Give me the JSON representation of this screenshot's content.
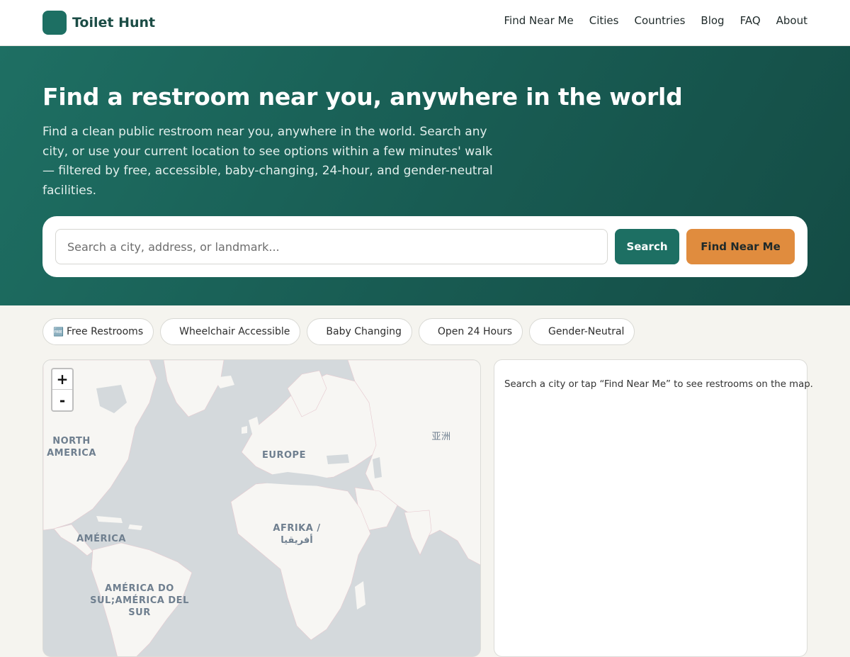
{
  "header": {
    "brand": "Toilet Hunt",
    "nav": [
      "Find Near Me",
      "Cities",
      "Countries",
      "Blog",
      "FAQ",
      "About"
    ]
  },
  "hero": {
    "title": "Find a restroom near you, anywhere in the world",
    "subtitle": "Find a clean public restroom near you, anywhere in the world. Search any city, or use your current location to see options within a few minutes' walk — filtered by free, accessible, baby-changing, 24-hour, and gender-neutral facilities."
  },
  "search": {
    "placeholder": "Search a city, address, or landmark...",
    "search_label": "Search",
    "near_label": "Find Near Me"
  },
  "filters": [
    {
      "label": "Free Restrooms",
      "icon": "🆓"
    },
    {
      "label": "Wheelchair Accessible",
      "icon": ""
    },
    {
      "label": "Baby Changing",
      "icon": ""
    },
    {
      "label": "Open 24 Hours",
      "icon": ""
    },
    {
      "label": "Gender-Neutral",
      "icon": ""
    }
  ],
  "map": {
    "zoom_in": "+",
    "zoom_out": "-",
    "labels": {
      "north_america": "NORTH AMERICA",
      "europe": "EUROPE",
      "asia": "亚洲",
      "africa": "AFRIKA / أفريقيا",
      "america": "AMÉRICA",
      "south_america": "AMÉRICA DO SUL;AMÉRICA DEL SUR"
    }
  },
  "results": {
    "empty_text": "Search a city or tap “Find Near Me” to see restrooms on the map."
  },
  "colors": {
    "brand": "#1d6f63",
    "accent": "#e08c3e",
    "background": "#f5f4ef"
  }
}
